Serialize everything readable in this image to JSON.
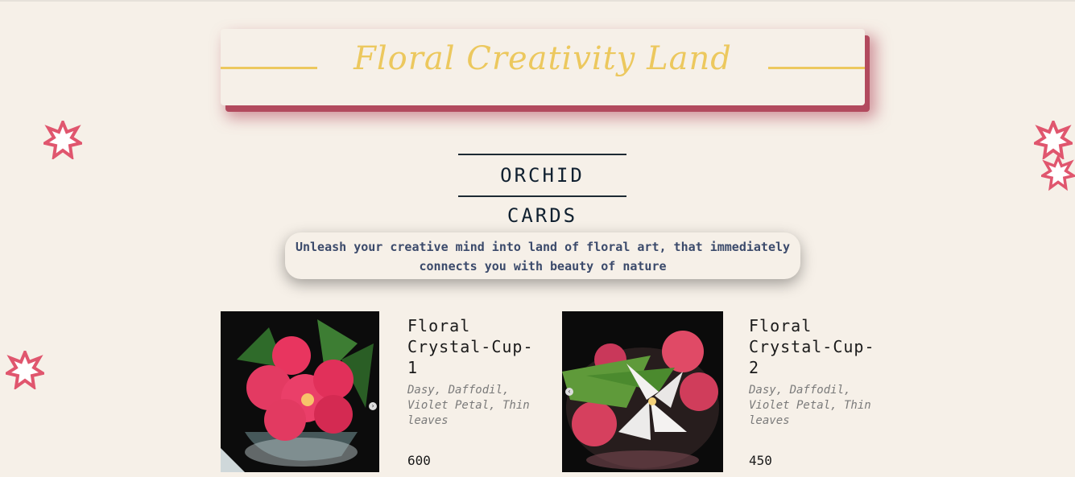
{
  "banner": {
    "title": "Floral Creativity Land"
  },
  "section": {
    "title": "ORCHID CARDS"
  },
  "tagline": {
    "text": "Unleash your creative mind into land of floral art, that immediately connects you with beauty of nature"
  },
  "products": [
    {
      "name": "Floral Crystal-Cup-1",
      "description": "Dasy, Daffodil, Violet Petal, Thin leaves",
      "price": "600"
    },
    {
      "name": "Floral Crystal-Cup-2",
      "description": "Dasy, Daffodil, Violet Petal, Thin leaves",
      "price": "450"
    }
  ],
  "colors": {
    "accent_gold": "#ecc85e",
    "banner_shadow": "#b24a5e",
    "decoration_pink": "#e0566e",
    "background": "#f6f0e8"
  },
  "icons": {
    "decoration": "flower-icon",
    "carousel_next": "chevron-right-icon",
    "carousel_prev": "chevron-left-icon"
  }
}
